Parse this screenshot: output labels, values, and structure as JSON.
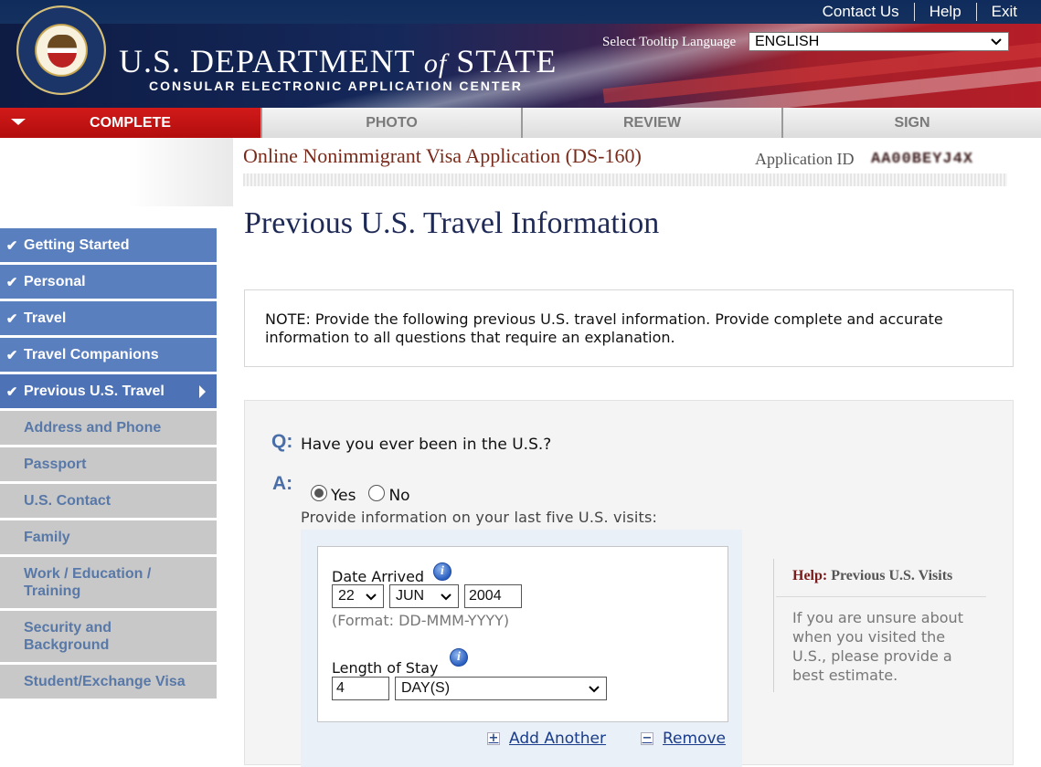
{
  "header": {
    "top_links": [
      "Contact Us",
      "Help",
      "Exit"
    ],
    "brand_line1_a": "U.S. DEPARTMENT ",
    "brand_line1_of": "of",
    "brand_line1_b": " STATE",
    "brand_line2": "CONSULAR ELECTRONIC APPLICATION CENTER",
    "tooltip_label": "Select Tooltip Language",
    "tooltip_value": "ENGLISH"
  },
  "steps": [
    "COMPLETE",
    "PHOTO",
    "REVIEW",
    "SIGN"
  ],
  "app": {
    "title": "Online Nonimmigrant Visa Application (DS-160)",
    "id_label": "Application ID",
    "id_value": "AA00BEYJ4X"
  },
  "nav": [
    {
      "label": "Getting Started",
      "state": "done"
    },
    {
      "label": "Personal",
      "state": "done"
    },
    {
      "label": "Travel",
      "state": "done"
    },
    {
      "label": "Travel Companions",
      "state": "done"
    },
    {
      "label": "Previous U.S. Travel",
      "state": "current"
    },
    {
      "label": "Address and Phone",
      "state": "todo"
    },
    {
      "label": "Passport",
      "state": "todo"
    },
    {
      "label": "U.S. Contact",
      "state": "todo"
    },
    {
      "label": "Family",
      "state": "todo"
    },
    {
      "label": "Work / Education / Training",
      "state": "todo"
    },
    {
      "label": "Security and Background",
      "state": "todo"
    },
    {
      "label": "Student/Exchange Visa",
      "state": "todo"
    }
  ],
  "page_title": "Previous U.S. Travel Information",
  "note": "NOTE: Provide the following previous U.S. travel information. Provide complete and accurate information to all questions that require an explanation.",
  "question": {
    "q_letter": "Q:",
    "a_letter": "A:",
    "text": "Have you ever been in the U.S.?",
    "yes_label": "Yes",
    "no_label": "No",
    "selected": "Yes"
  },
  "visits": {
    "intro": "Provide information on your last five U.S. visits:",
    "date_label": "Date Arrived",
    "day": "22",
    "month": "JUN",
    "year": "2004",
    "format_hint": "(Format: DD-MMM-YYYY)",
    "stay_label": "Length of Stay",
    "stay_value": "4",
    "stay_unit": "DAY(S)",
    "add_label": "Add Another",
    "remove_label": "Remove"
  },
  "help": {
    "prefix": "Help:",
    "topic": "Previous U.S. Visits",
    "body": "If you are unsure about when you visited the U.S., please provide a best estimate."
  },
  "icons": {
    "check": "check-icon",
    "info": "info-icon",
    "chevron": "chevron-down-icon",
    "plus": "plus-icon",
    "minus": "minus-icon"
  },
  "colors": {
    "nav_done": "#5a7fbf",
    "nav_todo": "#c8c8c8",
    "active_tab": "#c41414",
    "title_navy": "#1e2a55",
    "app_title": "#7a2a1a"
  }
}
